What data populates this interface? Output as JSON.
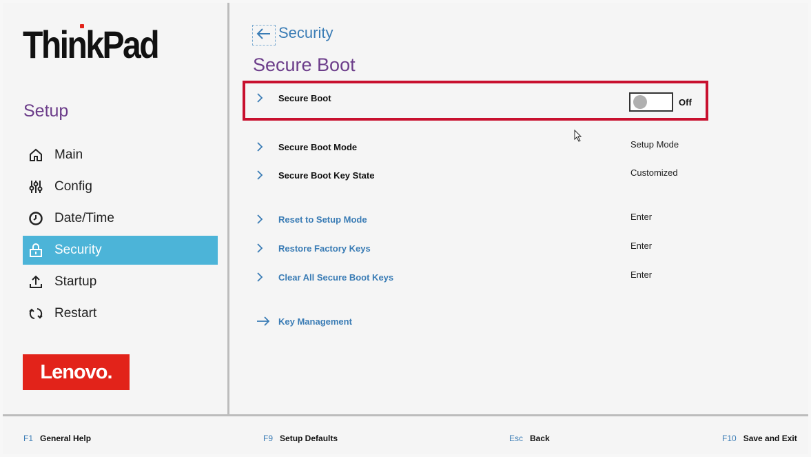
{
  "sidebar": {
    "brand": "ThinkPad",
    "setup_title": "Setup",
    "items": [
      {
        "label": "Main",
        "icon": "home-icon"
      },
      {
        "label": "Config",
        "icon": "sliders-icon"
      },
      {
        "label": "Date/Time",
        "icon": "clock-icon"
      },
      {
        "label": "Security",
        "icon": "lock-icon",
        "active": true
      },
      {
        "label": "Startup",
        "icon": "upload-icon"
      },
      {
        "label": "Restart",
        "icon": "restart-icon"
      }
    ],
    "logo": "Lenovo."
  },
  "main": {
    "breadcrumb": "Security",
    "title": "Secure Boot",
    "secure_boot": {
      "label": "Secure Boot",
      "state": "Off"
    },
    "rows": [
      {
        "label": "Secure Boot Mode",
        "value": "Setup Mode"
      },
      {
        "label": "Secure Boot Key State",
        "value": "Customized"
      },
      {
        "label": "Reset to Setup Mode",
        "value": "Enter"
      },
      {
        "label": "Restore Factory Keys",
        "value": "Enter"
      },
      {
        "label": "Clear All Secure Boot Keys",
        "value": "Enter"
      }
    ],
    "key_management": "Key Management"
  },
  "footer": {
    "help": {
      "key": "F1",
      "label": "General Help"
    },
    "defaults": {
      "key": "F9",
      "label": "Setup Defaults"
    },
    "back": {
      "key": "Esc",
      "label": "Back"
    },
    "save": {
      "key": "F10",
      "label": "Save and Exit"
    }
  },
  "colors": {
    "accent_purple": "#6c3d8a",
    "link_blue": "#3a7cb5",
    "active_bg": "#4cb4d8",
    "highlight_red": "#c8102e",
    "brand_red": "#e2231a"
  }
}
